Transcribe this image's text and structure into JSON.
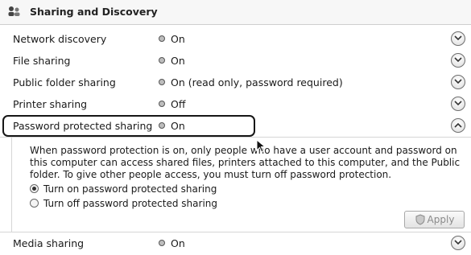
{
  "header": {
    "title": "Sharing and Discovery",
    "icon": "network-share-icon"
  },
  "rows": [
    {
      "label": "Network discovery",
      "status": "On"
    },
    {
      "label": "File sharing",
      "status": "On"
    },
    {
      "label": "Public folder sharing",
      "status": "On (read only, password required)"
    },
    {
      "label": "Printer sharing",
      "status": "Off"
    },
    {
      "label": "Password protected sharing",
      "status": "On",
      "expanded": true
    },
    {
      "label": "Media sharing",
      "status": "On"
    }
  ],
  "password_detail": {
    "description": "When password protection is on, only people who have a user account and password on this computer can access shared files, printers attached to this computer, and the Public folder. To give other people access, you must turn off password protection.",
    "options": [
      {
        "label": "Turn on password protected sharing",
        "checked": true
      },
      {
        "label": "Turn off password protected sharing",
        "checked": false
      }
    ],
    "apply_label": "Apply"
  },
  "colors": {
    "highlight_ring": "#161616",
    "row_divider": "#d6d6d6",
    "disabled_text": "#8a8a8a"
  }
}
